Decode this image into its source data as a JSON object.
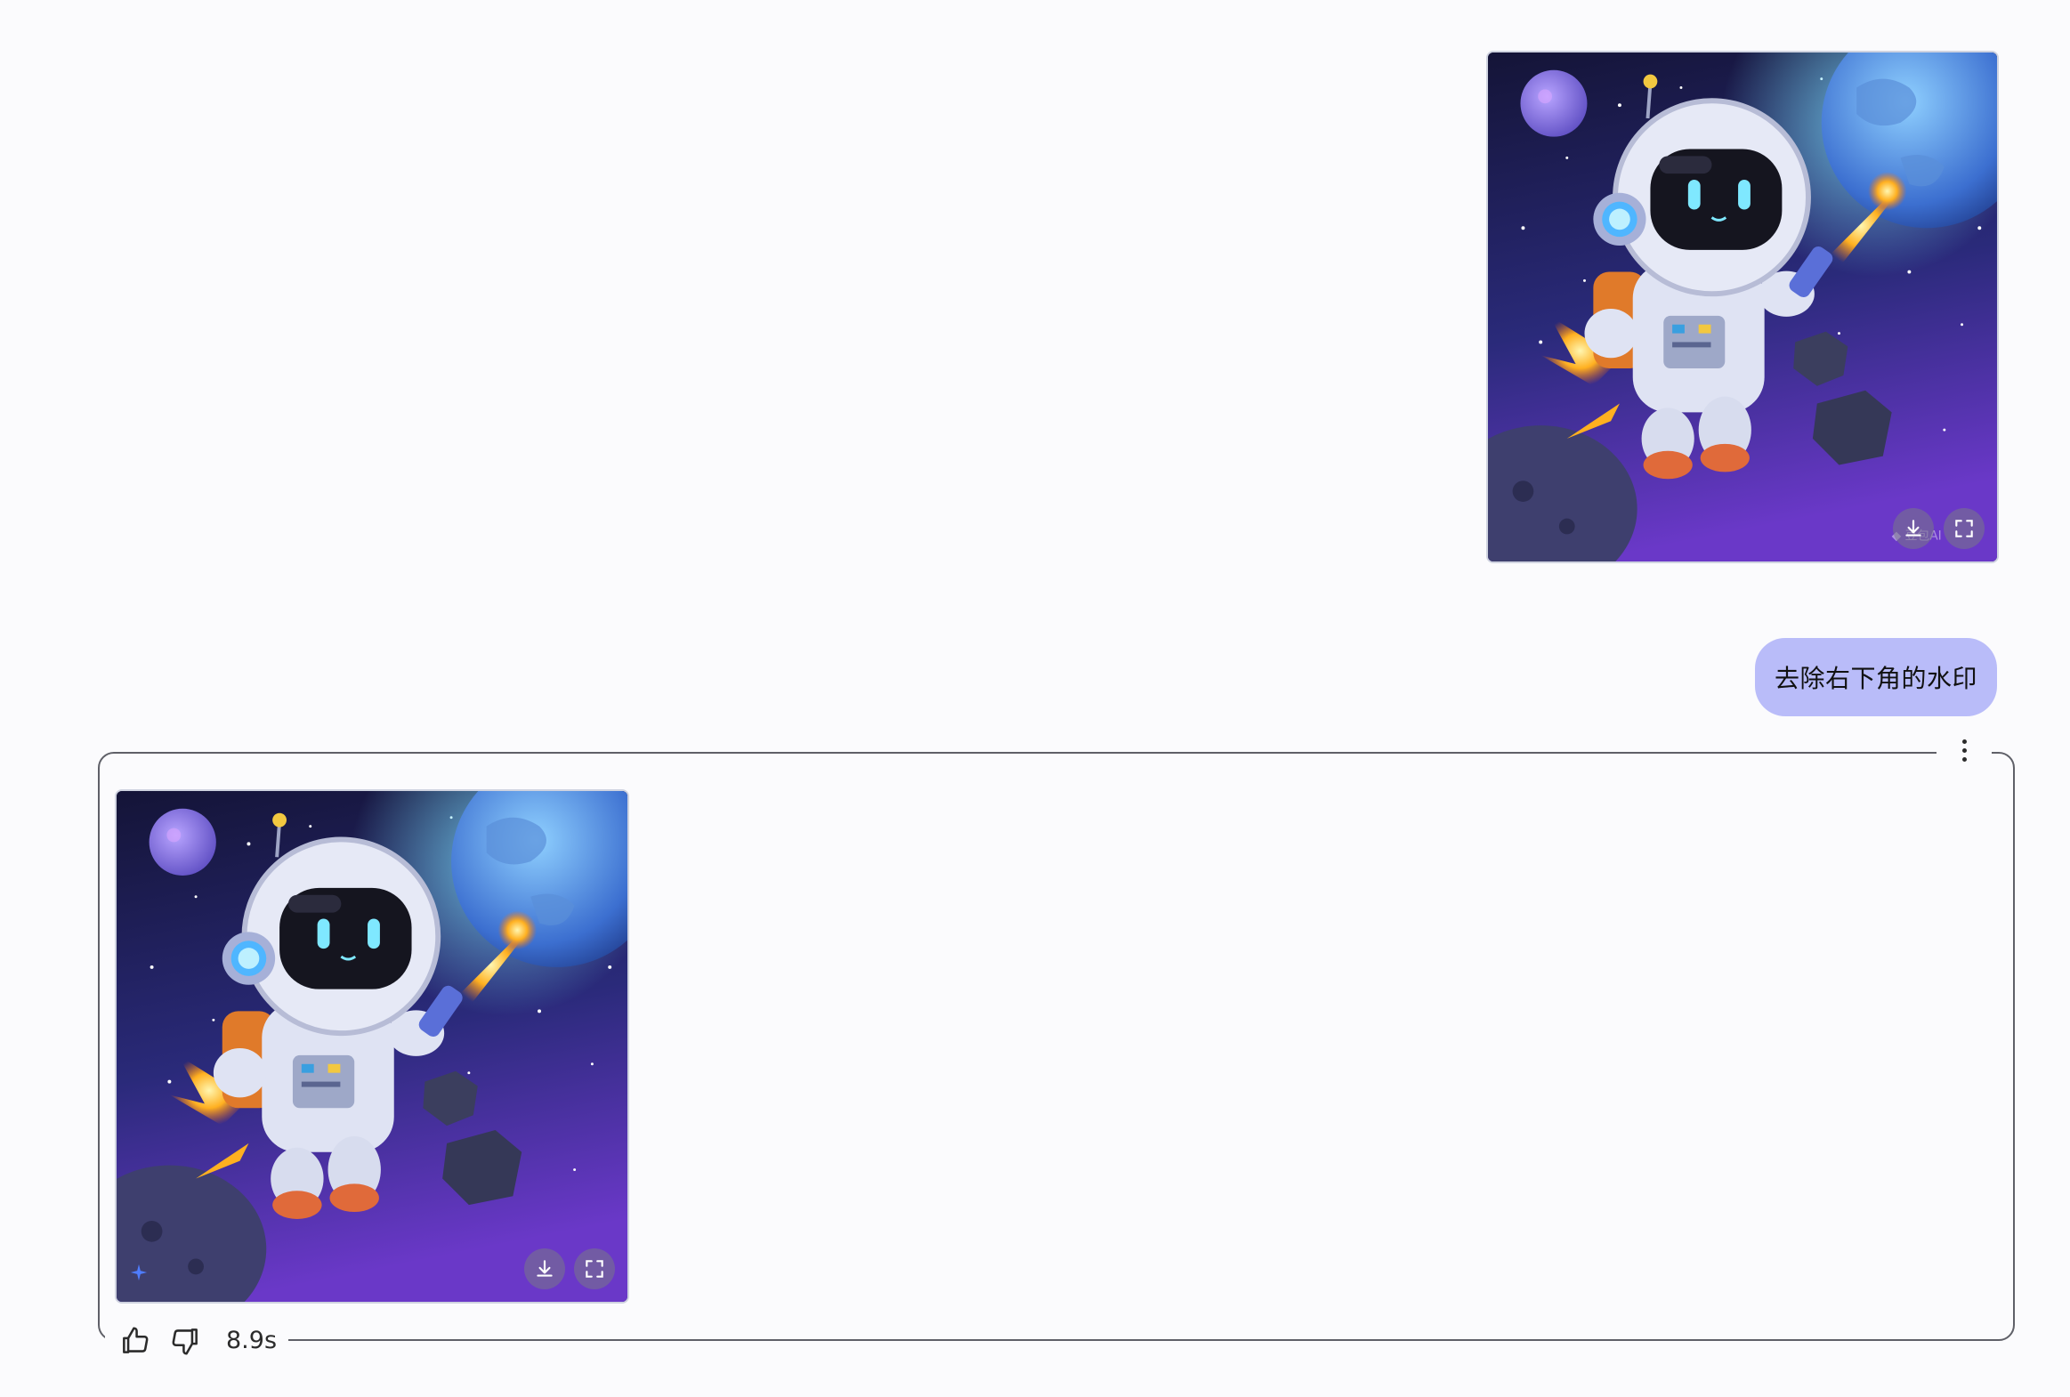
{
  "user_message": {
    "text": "去除右下角的水印",
    "image": {
      "alt": "cartoon astronaut robot flying in space with jetpack"
    }
  },
  "assistant_response": {
    "image": {
      "alt": "cartoon astronaut robot flying in space with jetpack, watermark removed"
    },
    "generation_time": "8.9s"
  },
  "image_actions": {
    "download_icon": "download-icon",
    "fullscreen_icon": "fullscreen-icon"
  },
  "icons": [
    "more-options-icon",
    "thumbs-up-icon",
    "thumbs-down-icon",
    "sparkle-icon"
  ],
  "colors": {
    "user_bubble": "#b9bcf9",
    "frame_border": "#5f6068",
    "background": "#fbfbfd"
  }
}
